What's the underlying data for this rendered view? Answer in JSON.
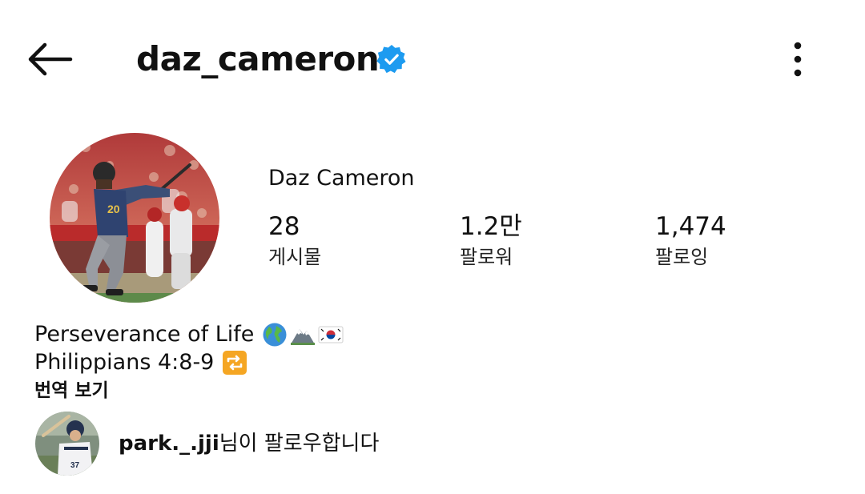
{
  "header": {
    "username": "daz_cameron",
    "verified_icon": "verified-badge-icon",
    "verified_color": "#1d9bf0",
    "back_icon": "arrow-left-icon",
    "more_icon": "more-vertical-icon"
  },
  "profile": {
    "display_name": "Daz Cameron",
    "avatar": "profile-photo",
    "stats": [
      {
        "value": "28",
        "label": "게시물"
      },
      {
        "value": "1.2만",
        "label": "팔로워"
      },
      {
        "value": "1,474",
        "label": "팔로잉"
      }
    ]
  },
  "bio": {
    "line1": "Perseverance of Life",
    "line1_emojis": [
      "globe-emoji",
      "mountain-emoji",
      "korea-flag-emoji"
    ],
    "line2": "Philippians 4:8-9",
    "line2_emojis": [
      "repeat-emoji"
    ],
    "translate_label": "번역 보기"
  },
  "followed_by": {
    "username": "park._.jji",
    "suffix": "님이 팔로우합니다",
    "avatar": "follower-photo"
  }
}
